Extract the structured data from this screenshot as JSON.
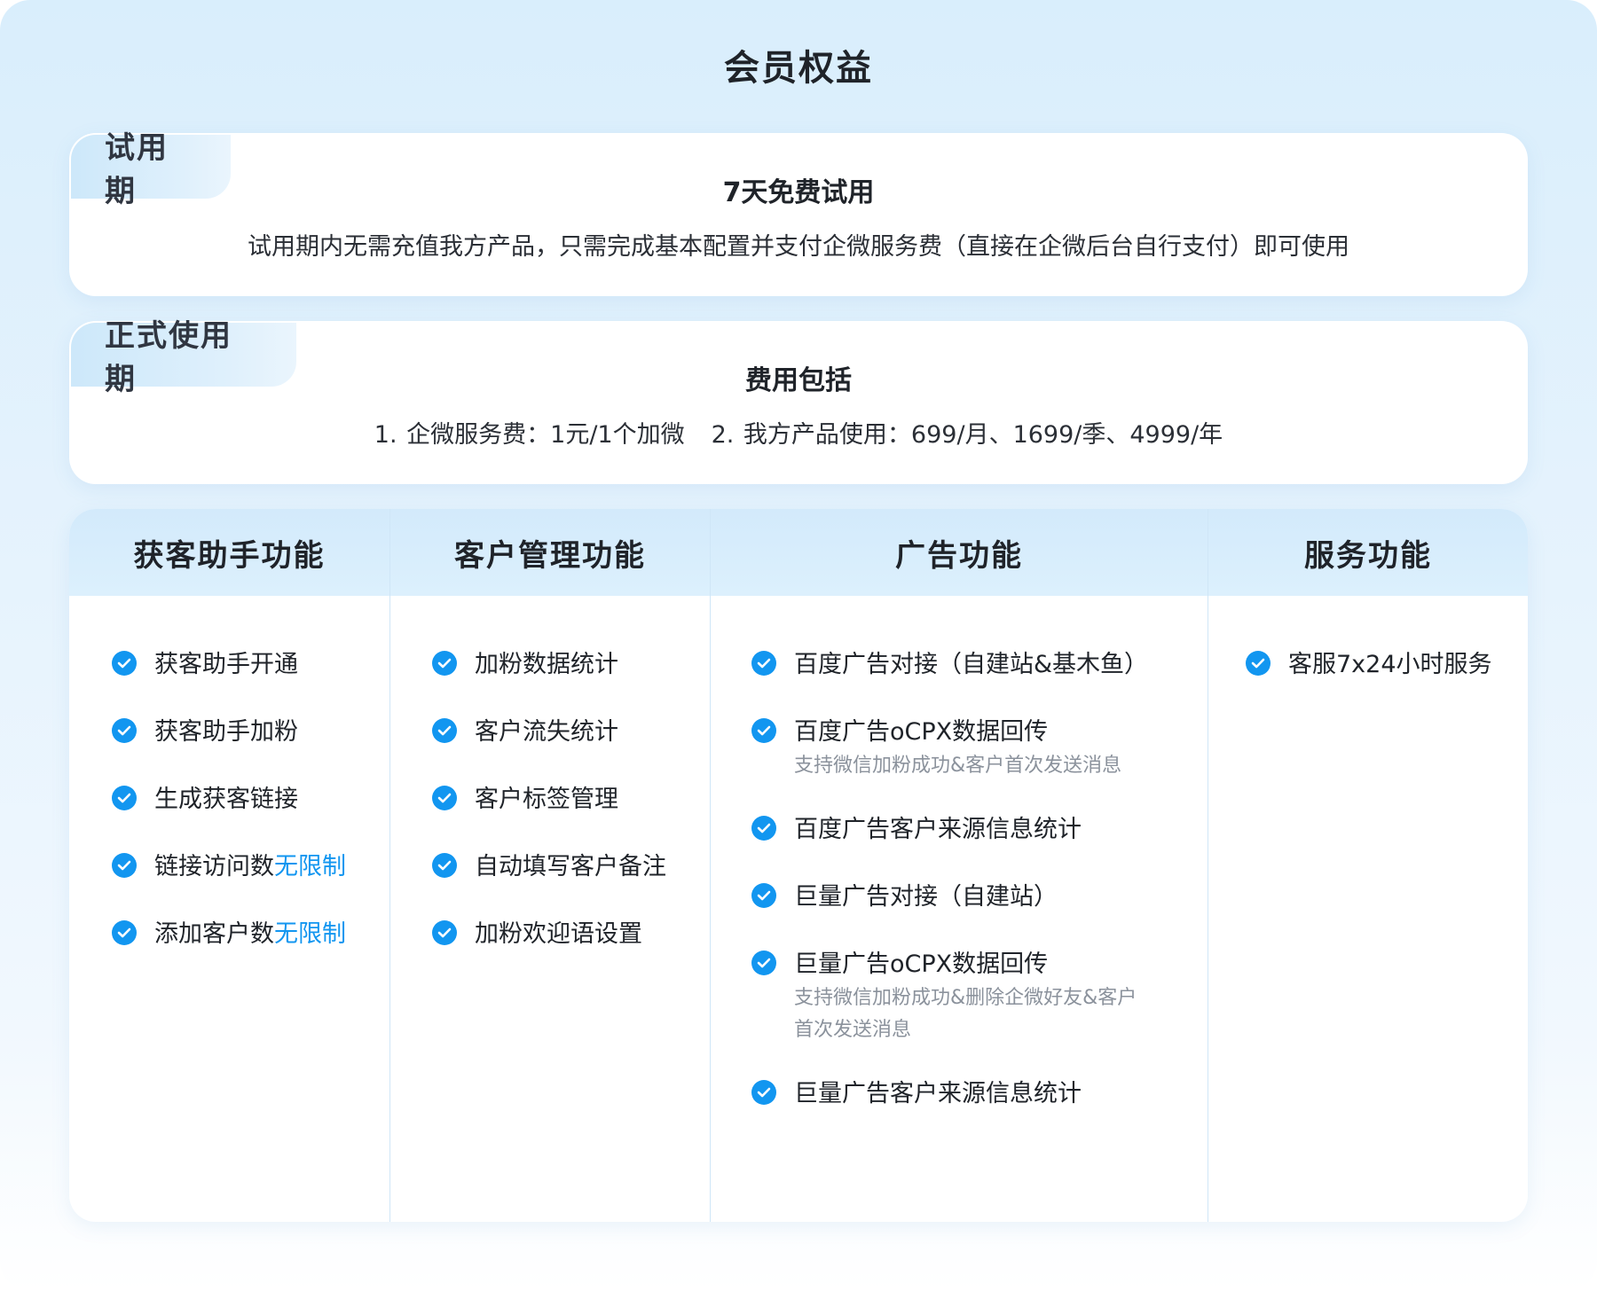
{
  "title": "会员权益",
  "trial": {
    "tag": "试用期",
    "heading": "7天免费试用",
    "desc": "试用期内无需充值我方产品，只需完成基本配置并支付企微服务费（直接在企微后台自行支付）即可使用"
  },
  "formal": {
    "tag": "正式使用期",
    "heading": "费用包括",
    "fee_1": "1. 企微服务费：1元/1个加微",
    "fee_2": "2. 我方产品使用：699/月、1699/季、4999/年"
  },
  "columns": [
    {
      "header": "获客助手功能",
      "items": [
        {
          "text": "获客助手开通"
        },
        {
          "text": "获客助手加粉"
        },
        {
          "text": "生成获客链接"
        },
        {
          "text": "链接访问数",
          "highlight": "无限制"
        },
        {
          "text": "添加客户数",
          "highlight": "无限制"
        }
      ]
    },
    {
      "header": "客户管理功能",
      "items": [
        {
          "text": "加粉数据统计"
        },
        {
          "text": "客户流失统计"
        },
        {
          "text": "客户标签管理"
        },
        {
          "text": "自动填写客户备注"
        },
        {
          "text": "加粉欢迎语设置"
        }
      ]
    },
    {
      "header": "广告功能",
      "items": [
        {
          "text": "百度广告对接（自建站&基木鱼）"
        },
        {
          "text": "百度广告oCPX数据回传",
          "sub": "支持微信加粉成功&客户首次发送消息"
        },
        {
          "text": "百度广告客户来源信息统计"
        },
        {
          "text": "巨量广告对接（自建站）"
        },
        {
          "text": "巨量广告oCPX数据回传",
          "sub_line1": "支持微信加粉成功&删除企微好友&客户",
          "sub_line2": "首次发送消息"
        },
        {
          "text": "巨量广告客户来源信息统计"
        }
      ]
    },
    {
      "header": "服务功能",
      "items": [
        {
          "text": "客服7x24小时服务"
        }
      ]
    }
  ],
  "colors": {
    "accent": "#1296f0",
    "header_bg": "#d6ecfb",
    "page_bg_top": "#d9eefc",
    "sub_text": "#8b929c"
  },
  "icons": {
    "check": "check-circle-icon"
  }
}
